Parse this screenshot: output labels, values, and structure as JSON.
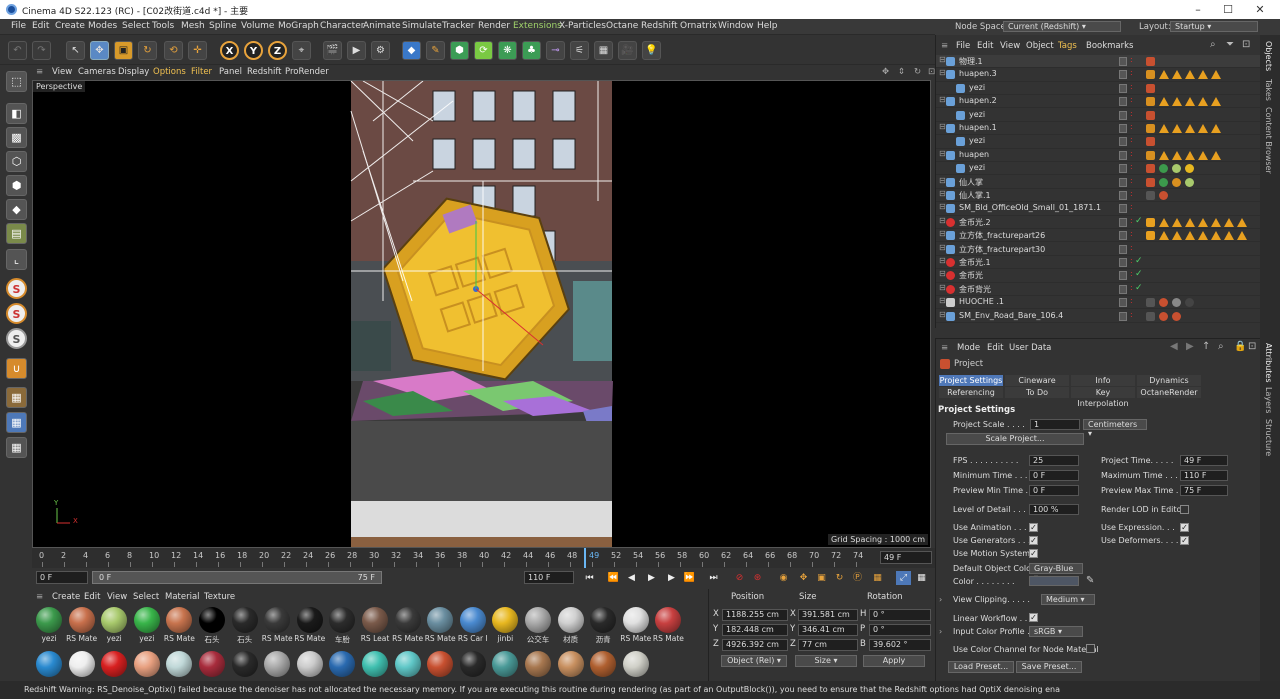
{
  "window": {
    "title": "Cinema 4D S22.123 (RC) - [C02改街道.c4d *] - 主要"
  },
  "menu": [
    "File",
    "Edit",
    "Create",
    "Modes",
    "Select",
    "Tools",
    "Mesh",
    "Spline",
    "Volume",
    "MoGraph",
    "Character",
    "Animate",
    "Simulate",
    "Tracker",
    "Render",
    "Extensions",
    "X-Particles",
    "Octane",
    "Redshift",
    "Ornatrix",
    "Window",
    "Help"
  ],
  "node_space": {
    "label": "Node Space:",
    "value": "Current (Redshift)"
  },
  "layout": {
    "label": "Layout:",
    "value": "Startup"
  },
  "viewport_menu": [
    "View",
    "Cameras",
    "Display",
    "Options",
    "Filter",
    "Panel",
    "Redshift",
    "ProRender"
  ],
  "viewport": {
    "label": "Perspective",
    "grid_spacing": "Grid Spacing : 1000 cm",
    "axis_x": "X",
    "axis_y": "Y"
  },
  "timeline": {
    "ticks": [
      "0",
      "2",
      "4",
      "6",
      "8",
      "10",
      "12",
      "14",
      "16",
      "18",
      "20",
      "22",
      "24",
      "26",
      "28",
      "30",
      "32",
      "34",
      "36",
      "38",
      "40",
      "42",
      "44",
      "46",
      "48",
      "49",
      "52",
      "54",
      "56",
      "58",
      "60",
      "62",
      "64",
      "66",
      "68",
      "70",
      "72",
      "74"
    ],
    "current": "49 F",
    "start": "0 F",
    "range_start": "0 F",
    "range_end": "75 F",
    "end": "110 F"
  },
  "material_menu": [
    "Create",
    "Edit",
    "View",
    "Select",
    "Material",
    "Texture"
  ],
  "materials_row1": [
    {
      "label": "yezi",
      "color": "#3c9a4c"
    },
    {
      "label": "RS Mate",
      "color": "#c8704c"
    },
    {
      "label": "yezi",
      "color": "#a8c96c"
    },
    {
      "label": "yezi",
      "color": "#39b54a"
    },
    {
      "label": "RS Mate",
      "color": "#c8744e"
    },
    {
      "label": "石头",
      "color": "#000000"
    },
    {
      "label": "石头",
      "color": "#2a2a2a"
    },
    {
      "label": "RS Mate",
      "color": "#3a3a3a"
    },
    {
      "label": "RS Mate",
      "color": "#1a1a1a"
    },
    {
      "label": "车胎",
      "color": "#2c2c2c"
    },
    {
      "label": "RS Leat",
      "color": "#7a5a4a"
    },
    {
      "label": "RS Mate",
      "color": "#3a3a3a"
    },
    {
      "label": "RS Mate",
      "color": "#6a8ea0"
    },
    {
      "label": "RS Car I",
      "color": "#4a8ad0"
    },
    {
      "label": "jinbi",
      "color": "#e8b820"
    },
    {
      "label": "公交车",
      "color": "#aaaaaa"
    },
    {
      "label": "材质",
      "color": "#d0d0d0"
    },
    {
      "label": "沥青",
      "color": "#2a2a2a"
    },
    {
      "label": "RS Mate",
      "color": "#e0e0e0"
    },
    {
      "label": "RS Mate",
      "color": "#c84040"
    }
  ],
  "materials_row2": [
    {
      "label": "",
      "color": "#2a8ad0"
    },
    {
      "label": "",
      "color": "#eeeeee"
    },
    {
      "label": "",
      "color": "#d82020"
    },
    {
      "label": "",
      "color": "#e8a080"
    },
    {
      "label": "",
      "color": "#c0d8d8"
    },
    {
      "label": "",
      "color": "#a82c3c"
    },
    {
      "label": "",
      "color": "#2a2a2a"
    },
    {
      "label": "",
      "color": "#aaaaaa"
    },
    {
      "label": "",
      "color": "#cccccc"
    },
    {
      "label": "",
      "color": "#2a6ab0"
    },
    {
      "label": "",
      "color": "#40c0b0"
    },
    {
      "label": "",
      "color": "#60c8c8"
    },
    {
      "label": "",
      "color": "#c85030"
    },
    {
      "label": "",
      "color": "#2a2a2a"
    },
    {
      "label": "",
      "color": "#4a9a98"
    },
    {
      "label": "",
      "color": "#a87850"
    },
    {
      "label": "",
      "color": "#c89060"
    },
    {
      "label": "",
      "color": "#b06030"
    },
    {
      "label": "",
      "color": "#d0d0c8"
    }
  ],
  "coords": {
    "headers": [
      "Position",
      "Size",
      "Rotation"
    ],
    "rows": [
      {
        "axis": "X",
        "pos": "1188.255 cm",
        "size_axis": "X",
        "size": "391.581 cm",
        "rot_axis": "H",
        "rot": "0 °"
      },
      {
        "axis": "Y",
        "pos": "182.448 cm",
        "size_axis": "Y",
        "size": "346.41 cm",
        "rot_axis": "P",
        "rot": "0 °"
      },
      {
        "axis": "Z",
        "pos": "4926.392 cm",
        "size_axis": "Z",
        "size": "77 cm",
        "rot_axis": "B",
        "rot": "39.602 °"
      }
    ],
    "mode": "Object (Rel)",
    "size_mode": "Size",
    "apply": "Apply"
  },
  "object_menu": [
    "File",
    "Edit",
    "View",
    "Object",
    "Tags",
    "Bookmarks"
  ],
  "objects": [
    {
      "name": "物理.1",
      "indent": 0,
      "icon": "#6aa0d8",
      "red": false
    },
    {
      "name": "huapen.3",
      "indent": 0,
      "icon": "#6aa0d8",
      "red": false
    },
    {
      "name": "yezi",
      "indent": 1,
      "icon": "#6aa0d8",
      "red": false
    },
    {
      "name": "huapen.2",
      "indent": 0,
      "icon": "#6aa0d8",
      "red": false
    },
    {
      "name": "yezi",
      "indent": 1,
      "icon": "#6aa0d8",
      "red": false
    },
    {
      "name": "huapen.1",
      "indent": 0,
      "icon": "#6aa0d8",
      "red": false
    },
    {
      "name": "yezi",
      "indent": 1,
      "icon": "#6aa0d8",
      "red": false
    },
    {
      "name": "huapen",
      "indent": 0,
      "icon": "#6aa0d8",
      "red": false
    },
    {
      "name": "yezi",
      "indent": 1,
      "icon": "#6aa0d8",
      "red": false
    },
    {
      "name": "仙人掌",
      "indent": 0,
      "icon": "#6aa0d8",
      "red": false
    },
    {
      "name": "仙人掌.1",
      "indent": 0,
      "icon": "#6aa0d8",
      "red": false
    },
    {
      "name": "SM_Bld_OfficeOld_Small_01_1871.1",
      "indent": 0,
      "icon": "#6aa0d8",
      "red": false
    },
    {
      "name": "金币光.2",
      "indent": 0,
      "icon": "#d83030",
      "red": true
    },
    {
      "name": "立方体_fracturepart26",
      "indent": 0,
      "icon": "#6aa0d8",
      "red": false
    },
    {
      "name": "立方体_fracturepart30",
      "indent": 0,
      "icon": "#6aa0d8",
      "red": false
    },
    {
      "name": "金币光.1",
      "indent": 0,
      "icon": "#d83030",
      "red": true
    },
    {
      "name": "金币光",
      "indent": 0,
      "icon": "#d83030",
      "red": true
    },
    {
      "name": "金币背光",
      "indent": 0,
      "icon": "#d83030",
      "red": true
    },
    {
      "name": "HUOCHE .1",
      "indent": 0,
      "icon": "#cccccc",
      "red": false
    },
    {
      "name": "SM_Env_Road_Bare_106.4",
      "indent": 0,
      "icon": "#6aa0d8",
      "red": false
    }
  ],
  "attr_menu": [
    "Mode",
    "Edit",
    "User Data"
  ],
  "attr_title": "Project",
  "attr_tabs_row1": [
    "Project Settings",
    "Cineware",
    "Info",
    "Dynamics"
  ],
  "attr_tabs_row2": [
    "Referencing",
    "To Do",
    "Key Interpolation",
    "OctaneRender"
  ],
  "attr_section": "Project Settings",
  "project_scale": {
    "label": "Project Scale . . . .",
    "value": "1",
    "unit": "Centimeters",
    "scale_btn": "Scale Project..."
  },
  "fields_left": [
    {
      "label": "FPS . . . . . . . . . .",
      "value": "25"
    },
    {
      "label": "Minimum Time . . .",
      "value": "0 F"
    },
    {
      "label": "Preview Min Time . .",
      "value": "0 F"
    },
    {
      "label": "Level of Detail . . .",
      "value": "100 %"
    }
  ],
  "fields_right": [
    {
      "label": "Project Time. . . . .",
      "value": "49 F"
    },
    {
      "label": "Maximum Time . . .",
      "value": "110 F"
    },
    {
      "label": "Preview Max Time . .",
      "value": "75 F"
    },
    {
      "label": "Render LOD in Editor",
      "value": ""
    }
  ],
  "checks_left": [
    "Use Animation . . .",
    "Use Generators . . .",
    "Use Motion System"
  ],
  "checks_right": [
    "Use Expression. . .",
    "Use Deformers. . . ."
  ],
  "default_color": {
    "label": "Default Object Color",
    "value": "Gray-Blue",
    "color_label": "Color . . . . . . . ."
  },
  "view_clipping": {
    "label": "View Clipping. . . . .",
    "value": "Medium"
  },
  "linear_workflow": "Linear Workflow . . .",
  "input_color": {
    "label": "Input Color Profile . .",
    "value": "sRGB"
  },
  "node_material": "Use Color Channel for Node Material",
  "load_preset": "Load Preset...",
  "save_preset": "Save Preset...",
  "side_tabs_top": [
    "Objects",
    "Takes",
    "Content Browser"
  ],
  "side_tabs_bottom": [
    "Attributes",
    "Layers",
    "Structure"
  ],
  "status": "Redshift Warning: RS_Denoise_Optix() failed because the denoiser has not allocated the necessary memory. If you are executing this routine during rendering (as part of an OutputBlock()), you need to ensure that the Redshift options had OptiX denoising ena"
}
